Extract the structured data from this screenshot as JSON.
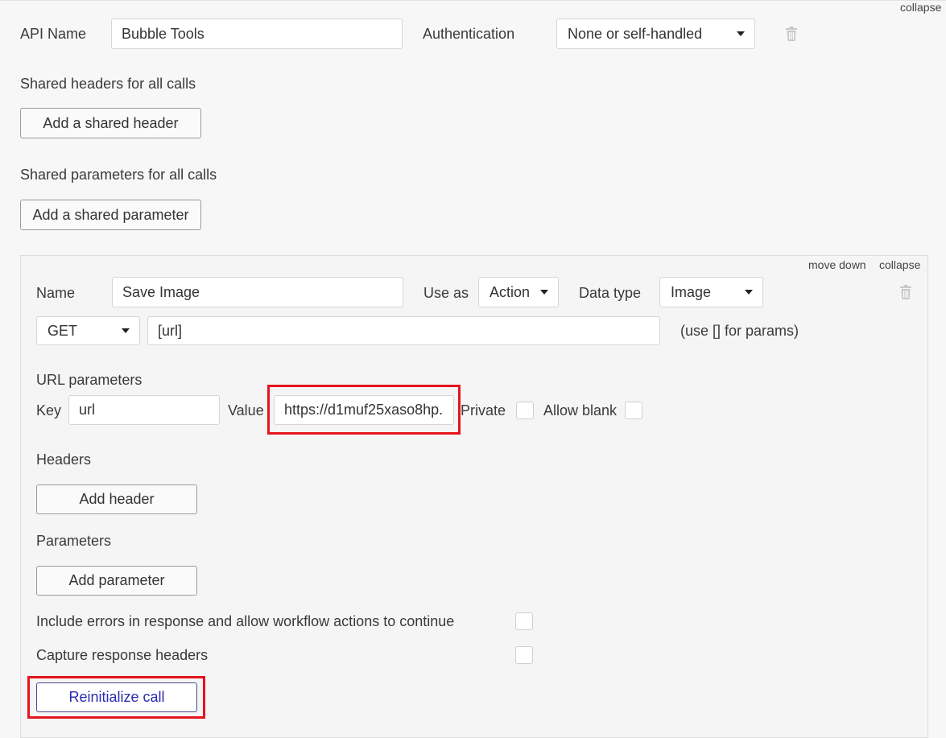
{
  "api": {
    "collapse_label": "collapse",
    "name_label": "API Name",
    "name_value": "Bubble Tools",
    "auth_label": "Authentication",
    "auth_value": "None or self-handled",
    "shared_headers_label": "Shared headers for all calls",
    "add_shared_header": "Add a shared header",
    "shared_params_label": "Shared parameters for all calls",
    "add_shared_param": "Add a shared parameter"
  },
  "call": {
    "move_down": "move down",
    "collapse": "collapse",
    "name_label": "Name",
    "name_value": "Save Image",
    "use_as_label": "Use as",
    "use_as_value": "Action",
    "data_type_label": "Data type",
    "data_type_value": "Image",
    "method": "GET",
    "url": "[url]",
    "url_hint": "(use [] for params)",
    "url_params_label": "URL parameters",
    "key_label": "Key",
    "key_value": "url",
    "value_label": "Value",
    "value_value": "https://d1muf25xaso8hp.",
    "private_label": "Private",
    "allow_blank_label": "Allow blank",
    "headers_label": "Headers",
    "add_header": "Add header",
    "parameters_label": "Parameters",
    "add_parameter": "Add parameter",
    "include_errors_label": "Include errors in response and allow workflow actions to continue",
    "capture_headers_label": "Capture response headers",
    "reinitialize": "Reinitialize call"
  },
  "icons": {
    "trash": "trash-icon",
    "caret": "caret-down-icon"
  },
  "colors": {
    "highlight": "#e5141e",
    "primary_text": "#2b2bb3"
  }
}
